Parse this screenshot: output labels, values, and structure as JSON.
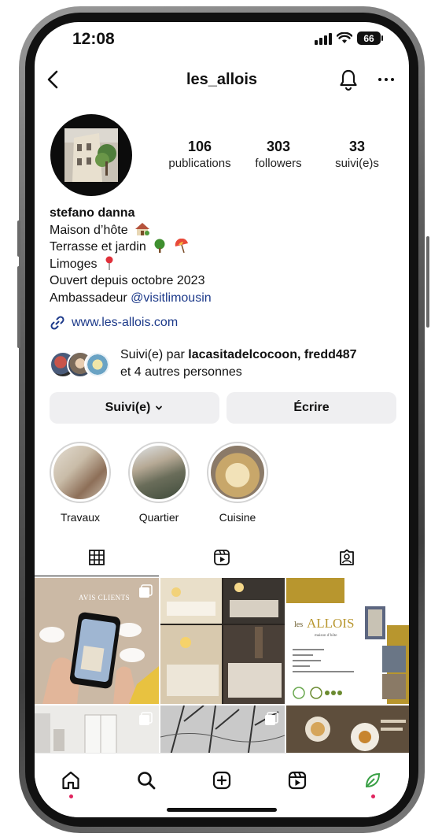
{
  "status_bar": {
    "time": "12:08",
    "battery": "66"
  },
  "header": {
    "username": "les_allois"
  },
  "profile": {
    "stats": [
      {
        "value": "106",
        "label": "publications"
      },
      {
        "value": "303",
        "label": "followers"
      },
      {
        "value": "33",
        "label": "suivi(e)s"
      }
    ],
    "name": "stefano danna",
    "bio": {
      "line1": "Maison d’hôte",
      "line2": "Terrasse et jardin",
      "line3": "Limoges",
      "line4": "Ouvert depuis octobre 2023",
      "line5_prefix": "Ambassadeur ",
      "line5_mention": "@visitlimousin"
    },
    "website": "www.les-allois.com",
    "followed_by": {
      "prefix": "Suivi(e) par ",
      "names": "lacasitadelcocoon, fredd487",
      "suffix": "et 4 autres personnes"
    }
  },
  "actions": {
    "following_label": "Suivi(e)",
    "message_label": "Écrire"
  },
  "highlights": [
    {
      "label": "Travaux"
    },
    {
      "label": "Quartier"
    },
    {
      "label": "Cuisine"
    }
  ],
  "posts": {
    "post1_title": "AVIS CLIENTS",
    "post3_logo_a": "les",
    "post3_logo_b": "ALLOIS",
    "post3_sub": "maison d’hôte"
  },
  "colors": {
    "accent_link": "#1d3a8a",
    "notification_dot": "#e0245e",
    "button_bg": "#efeff1",
    "brand_gold": "#b8962e"
  },
  "icons": {
    "back": "chevron-left-icon",
    "bell": "bell-icon",
    "more": "more-horizontal-icon",
    "link": "link-icon",
    "grid_tab": "grid-icon",
    "reels_tab": "reels-icon",
    "tagged_tab": "tagged-icon",
    "nav": [
      "home-icon",
      "search-icon",
      "create-icon",
      "reels-icon",
      "profile-leaf-icon"
    ]
  }
}
